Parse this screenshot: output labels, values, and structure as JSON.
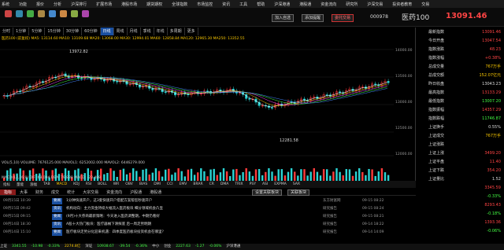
{
  "menu": [
    "系统",
    "功能",
    "报价",
    "分析",
    "沪深排行",
    "扩展市场",
    "港股市场",
    "期货期权",
    "全球指数",
    "市场监控",
    "资讯",
    "工具",
    "帮助",
    "沪深港通",
    "港股通",
    "资金流向",
    "研究所",
    "沪深交易",
    "投资者教育",
    "交易"
  ],
  "toolbar": {
    "add_label": "加入自选",
    "del_label": "添加提醒",
    "warn_label": "委托交易",
    "code": "000978",
    "name": "医药100",
    "price": "13091.46",
    "price_arrow": "▲"
  },
  "chart": {
    "tabs": [
      "分时",
      "1分钟",
      "5分钟",
      "15分钟",
      "30分钟",
      "60分钟",
      "日线",
      "周线",
      "月线",
      "季线",
      "年线",
      "多周期",
      "更多"
    ],
    "active_tab": "日线",
    "ma_line": "医药100 (前复权)  MA5: 13114.60  MA10: 13109.68  MA20: 13068.00  MA30: 12994.01  MA60: 12858.84  MA120: 12965.30  MA250: 13352.55",
    "high_label": "13972.82",
    "low_label": "12281.58",
    "y_ticks": [
      "14000.00",
      "13500.00",
      "13000.00",
      "12500.00",
      "12000.00"
    ],
    "vol_line": "VOL(5,10)  VOLUME: 7676125.000  MAVOL1: 6252002.000  MAVOL2: 6446279.000",
    "macd_line": "MACD(12,26,9)  DIF: 68.094  DEA: 79.838  MACD: -23.488",
    "vol_ticks": [
      "1000万",
      "0"
    ],
    "macd_ticks": [
      "104.24",
      "0",
      "-209.17"
    ],
    "x_labels": [
      "2019",
      "06",
      "07",
      "08",
      "09"
    ],
    "mode_btns": [
      "多维度",
      "估值比",
      "综合"
    ]
  },
  "quote": {
    "title": "指数详情",
    "rows": [
      {
        "lab": "最新指数",
        "val": "13091.46",
        "c": "#ff4444"
      },
      {
        "lab": "今日开盘",
        "val": "13047.54",
        "c": "#ff4444"
      },
      {
        "lab": "指数涨跌",
        "val": "48.23",
        "c": "#ff4444"
      },
      {
        "lab": "指数涨幅",
        "val": "+0.38%",
        "c": "#ff4444"
      },
      {
        "lab": "总成交量",
        "val": "767万手",
        "c": "#ffcc00"
      },
      {
        "lab": "总成交额",
        "val": "152.07亿元",
        "c": "#ffcc00"
      },
      {
        "lab": "昨日收盘",
        "val": "13043.23",
        "c": "#ddd"
      },
      {
        "lab": "最高指数",
        "val": "13133.29",
        "c": "#ff4444"
      },
      {
        "lab": "最低指数",
        "val": "13007.20",
        "c": "#44ff44"
      },
      {
        "lab": "指数振幅",
        "val": "14357.29",
        "c": "#ff4444"
      },
      {
        "lab": "指数跌幅",
        "val": "11746.87",
        "c": "#44ff44"
      },
      {
        "lab": "上证换手",
        "val": "0.55%",
        "c": "#ddd"
      },
      {
        "lab": "上证成交",
        "val": "767万手",
        "c": "#ffcc00"
      },
      {
        "lab": "上证涨跌",
        "val": "",
        "c": "#ddd"
      },
      {
        "lab": "上证上涨",
        "val": "3499.20",
        "c": "#ff4444"
      },
      {
        "lab": "上证平盘",
        "val": "11.40",
        "c": "#ff4444"
      },
      {
        "lab": "上证下跌",
        "val": "354.20",
        "c": "#ff4444"
      },
      {
        "lab": "上证量比",
        "val": "1.52",
        "c": "#ddd"
      },
      {
        "lab": "",
        "val": "3345.59",
        "c": "#ff4444"
      },
      {
        "lab": "",
        "val": "-0.33%",
        "c": "#44ff44"
      },
      {
        "lab": "",
        "val": "8293.43",
        "c": "#ff4444"
      },
      {
        "lab": "",
        "val": "-0.18%",
        "c": "#44ff44"
      },
      {
        "lab": "",
        "val": "1393.36",
        "c": "#ff4444"
      },
      {
        "lab": "",
        "val": "-0.06%",
        "c": "#44ff44"
      }
    ]
  },
  "subtabs": [
    "指标",
    "量能",
    "涨幅",
    "TAB",
    "MACD",
    "KDJ",
    "RSI",
    "BOLL",
    "WR",
    "OBV",
    "BIAS",
    "DMI",
    "CCI",
    "EMV",
    "BRAR",
    "CR",
    "DMA",
    "TRIX",
    "PSY",
    "ASI",
    "EXPMA",
    "SAR"
  ],
  "newstabs": [
    "指标",
    "大事",
    "财务",
    "成交",
    "统计",
    "大宗交易",
    "资金流向",
    "沪股通",
    "港股通"
  ],
  "news_buttons": [
    "设置关联板块",
    "关联板块"
  ],
  "news": [
    {
      "time": "09月15日 10:39",
      "tag": "要闻",
      "text": "1分钟快速开户，这3套快速开户搭配方案帮您秒速开户",
      "src": "东方财富网",
      "date": "09-15 08:22"
    },
    {
      "time": "09月15日 09:42",
      "tag": "资讯",
      "text": "机构动向：主力资金持续大幅流入医药板块 细分领域机会凸显",
      "src": "研究报告",
      "date": "09-15 08:24"
    },
    {
      "time": "09月15日 09:15",
      "tag": "要闻",
      "text": "(9月)十大券商最新策略：今天进入医药调整期，中期仍看好",
      "src": "研究报告",
      "date": "09-15 08:21"
    },
    {
      "time": "09月14日 18:30",
      "tag": "资讯",
      "text": "A股十大热门板块：医疗器械下滑探底 后一周走势明朗",
      "src": "研究报告",
      "date": "09-14 18:22"
    },
    {
      "time": "09月14日 15:10",
      "tag": "要闻",
      "text": "医疗板块走势分化迎来机遇：四季度医药板块投资机会在哪里？",
      "src": "研究报告",
      "date": "09-14 14:09"
    }
  ],
  "status": [
    {
      "t": "上证",
      "c": "#ddd"
    },
    {
      "t": "3341.55",
      "c": "#44ff44"
    },
    {
      "t": "-10.98",
      "c": "#44ff44"
    },
    {
      "t": "-0.33%",
      "c": "#44ff44"
    },
    {
      "t": "2274.8亿",
      "c": "#ffcc00"
    },
    {
      "t": "深证",
      "c": "#ddd"
    },
    {
      "t": "10938.67",
      "c": "#44ff44"
    },
    {
      "t": "-39.54",
      "c": "#44ff44"
    },
    {
      "t": "-0.36%",
      "c": "#44ff44"
    },
    {
      "t": "中小",
      "c": "#ddd"
    },
    {
      "t": "创业",
      "c": "#ddd"
    },
    {
      "t": "2227.63",
      "c": "#44ff44"
    },
    {
      "t": "-1.27",
      "c": "#44ff44"
    },
    {
      "t": "-0.06%",
      "c": "#44ff44"
    },
    {
      "t": "沪深港通",
      "c": "#ddd"
    }
  ],
  "watermark": "金融界"
}
